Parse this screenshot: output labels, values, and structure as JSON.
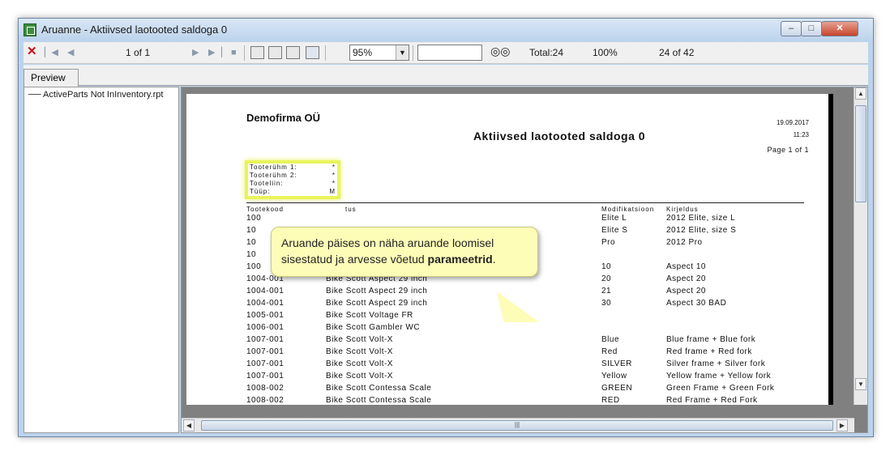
{
  "window": {
    "title": "Aruanne - Aktiivsed laotooted saldoga 0"
  },
  "toolbar": {
    "page_indicator": "1 of 1",
    "zoom": "95%",
    "search_value": "",
    "total": "Total:24",
    "percent": "100%",
    "count": "24 of 42"
  },
  "tabs": {
    "preview": "Preview"
  },
  "tree": {
    "item": "ActiveParts Not InInventory.rpt"
  },
  "report": {
    "company": "Demofirma OÜ",
    "title": "Aktiivsed laotooted saldoga 0",
    "date": "19.09.2017",
    "time": "11:23",
    "page": "Page 1 of 1",
    "params": [
      {
        "label": "Tooterühm 1:",
        "value": "*"
      },
      {
        "label": "Tooterühm 2:",
        "value": "*"
      },
      {
        "label": "Tooteliin:",
        "value": "*"
      },
      {
        "label": "Tüüp:",
        "value": "M"
      }
    ],
    "columns": [
      "Tootekood",
      "tus",
      "Modifikatsioon",
      "Kirjeldus"
    ],
    "rows": [
      [
        "100",
        "",
        "Elite L",
        "2012 Elite, size L"
      ],
      [
        "10",
        "",
        "Elite S",
        "2012 Elite, size S"
      ],
      [
        "10",
        "",
        "Pro",
        "2012 Pro"
      ],
      [
        "10",
        "",
        "",
        ""
      ],
      [
        "100",
        "",
        "10",
        "Aspect 10"
      ],
      [
        "1004-001",
        "Bike Scott Aspect 29 inch",
        "20",
        "Aspect 20"
      ],
      [
        "1004-001",
        "Bike Scott Aspect 29 inch",
        "21",
        "Aspect 20"
      ],
      [
        "1004-001",
        "Bike Scott Aspect 29 inch",
        "30",
        "Aspect 30 BAD"
      ],
      [
        "1005-001",
        "Bike Scott Voltage FR",
        "",
        ""
      ],
      [
        "1006-001",
        "Bike Scott Gambler WC",
        "",
        ""
      ],
      [
        "1007-001",
        "Bike Scott Volt-X",
        "Blue",
        "Blue frame + Blue fork"
      ],
      [
        "1007-001",
        "Bike Scott Volt-X",
        "Red",
        "Red frame + Red fork"
      ],
      [
        "1007-001",
        "Bike Scott Volt-X",
        "SILVER",
        "Silver frame + Silver fork"
      ],
      [
        "1007-001",
        "Bike Scott Volt-X",
        "Yellow",
        "Yellow frame + Yellow fork"
      ],
      [
        "1008-002",
        "Bike Scott Contessa Scale",
        "GREEN",
        "Green Frame + Green Fork"
      ],
      [
        "1008-002",
        "Bike Scott Contessa Scale",
        "RED",
        "Red Frame + Red Fork"
      ]
    ]
  },
  "callout": {
    "text_before": "Aruande päises on näha aruande loomisel sisestatud ja arvesse võetud ",
    "text_bold": "parameetrid",
    "text_after": "."
  },
  "colors": {
    "highlight": "#e8f45a",
    "callout_bg": "#fdfdb8",
    "close_red": "#c7121b"
  },
  "icons": [
    "close-icon",
    "first-page-icon",
    "prev-page-icon",
    "next-page-icon",
    "last-page-icon",
    "stop-icon",
    "print-icon",
    "print-setup-icon",
    "export-icon",
    "group-tree-icon",
    "binoculars-icon"
  ]
}
